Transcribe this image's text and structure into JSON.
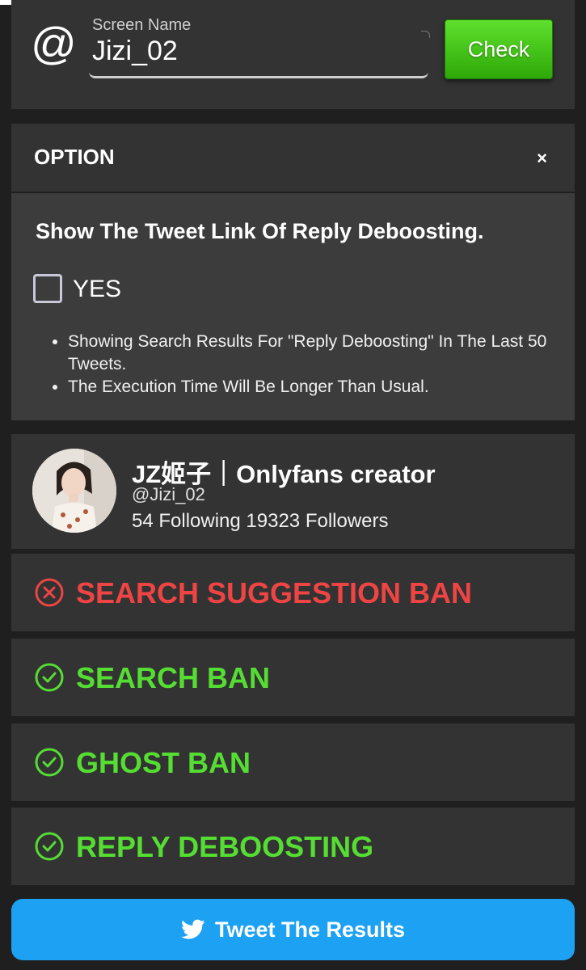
{
  "search": {
    "at_symbol": "@",
    "label": "Screen Name",
    "value": "Jizi_02",
    "button_label": "Check",
    "button_color": "#3cc614"
  },
  "option": {
    "title": "OPTION",
    "close_symbol": "×",
    "question": "Show The Tweet Link Of Reply Deboosting.",
    "checkbox_label": "YES",
    "checkbox_checked": false,
    "notes": [
      "Showing Search Results For \"Reply Deboosting\" In The Last 50 Tweets.",
      "The Execution Time Will Be Longer Than Usual."
    ]
  },
  "profile": {
    "name": "JZ姬子｜Onlyfans creator",
    "handle": "@Jizi_02",
    "stats": "54 Following 19323 Followers"
  },
  "results": [
    {
      "label": "SEARCH SUGGESTION BAN",
      "status": "banned",
      "icon": "x-circle-icon",
      "color": "#ee4444"
    },
    {
      "label": "SEARCH BAN",
      "status": "ok",
      "icon": "check-circle-icon",
      "color": "#55dd33"
    },
    {
      "label": "GHOST BAN",
      "status": "ok",
      "icon": "check-circle-icon",
      "color": "#55dd33"
    },
    {
      "label": "REPLY DEBOOSTING",
      "status": "ok",
      "icon": "check-circle-icon",
      "color": "#55dd33"
    }
  ],
  "tweet": {
    "label": "Tweet The Results",
    "icon": "twitter-bird-icon",
    "color": "#1da1f2"
  }
}
